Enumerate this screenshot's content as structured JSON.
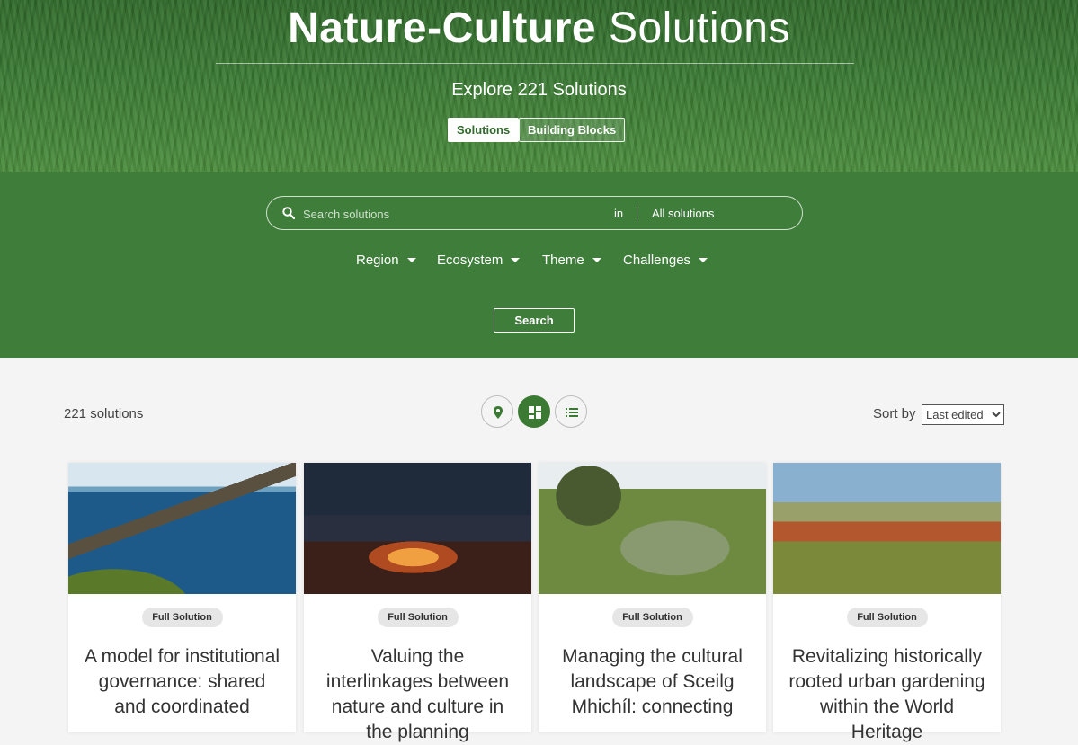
{
  "hero": {
    "title_bold": "Nature-Culture",
    "title_light": "Solutions",
    "subtitle": "Explore 221 Solutions",
    "toggle_solutions": "Solutions",
    "toggle_blocks": "Building Blocks"
  },
  "search": {
    "placeholder": "Search solutions",
    "in_label": "in",
    "scope": "All solutions",
    "button": "Search"
  },
  "filters": {
    "region": "Region",
    "ecosystem": "Ecosystem",
    "theme": "Theme",
    "challenges": "Challenges"
  },
  "results": {
    "count": "221 solutions",
    "sort_label": "Sort by",
    "sort_value": "Last edited",
    "active_view": "grid"
  },
  "colors": {
    "brand_green": "#3f7d3b",
    "accent_green": "#3a7a33"
  },
  "icons": {
    "map": "map-pin-icon",
    "grid": "grid-icon",
    "list": "list-icon",
    "search": "search-icon"
  },
  "cards": [
    {
      "badge": "Full Solution",
      "title": "A model for institutional governance: shared and coordinated"
    },
    {
      "badge": "Full Solution",
      "title": "Valuing the interlinkages between nature and culture in the planning"
    },
    {
      "badge": "Full Solution",
      "title": "Managing the cultural landscape of Sceilg Mhichíl: connecting"
    },
    {
      "badge": "Full Solution",
      "title": "Revitalizing historically rooted urban gardening within the World Heritage"
    }
  ]
}
